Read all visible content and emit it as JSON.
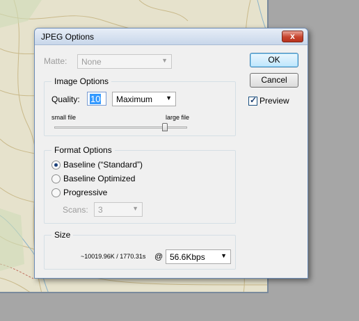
{
  "dialog": {
    "title": "JPEG Options",
    "close_glyph": "x"
  },
  "matte": {
    "label": "Matte:",
    "value": "None"
  },
  "buttons": {
    "ok": "OK",
    "cancel": "Cancel"
  },
  "preview": {
    "label": "Preview",
    "checked": true
  },
  "image_options": {
    "legend": "Image Options",
    "quality_label": "Quality:",
    "quality_value": "10",
    "quality_preset": "Maximum",
    "small_file_label": "small file",
    "large_file_label": "large file",
    "slider_level": 0.83
  },
  "format_options": {
    "legend": "Format Options",
    "baseline_standard": "Baseline (“Standard”)",
    "baseline_optimized": "Baseline Optimized",
    "progressive": "Progressive",
    "selected": "baseline_standard",
    "scans_label": "Scans:",
    "scans_value": "3"
  },
  "size": {
    "legend": "Size",
    "estimate": "~10019.96K / 1770.31s",
    "at": "@",
    "speed": "56.6Kbps"
  },
  "icons": {
    "dropdown_arrow": "chevron-down-icon",
    "check": "checkmark-icon",
    "close": "close-icon"
  },
  "colors": {
    "close_button": "#c7452f",
    "selection": "#3399ff",
    "default_button_border": "#3c7fb1"
  }
}
